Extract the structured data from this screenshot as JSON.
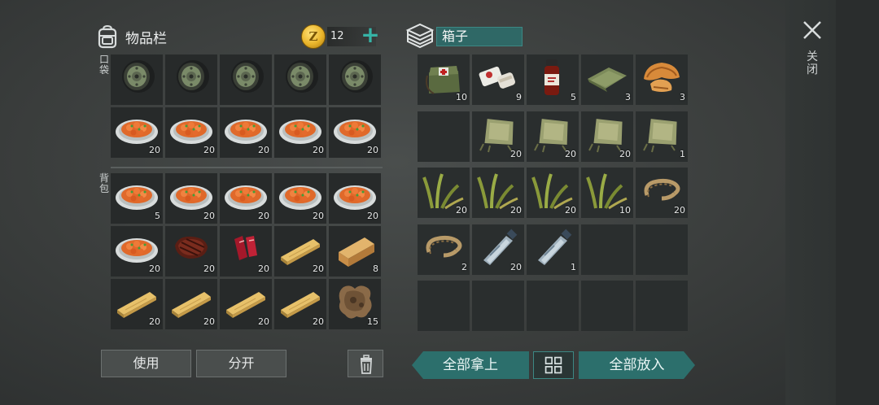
{
  "inventory": {
    "title": "物品栏",
    "coins": "12",
    "pocket_label": "口袋",
    "backpack_label": "背包",
    "pocket": [
      {
        "icon": "wheel-icon",
        "count": ""
      },
      {
        "icon": "wheel-icon",
        "count": ""
      },
      {
        "icon": "wheel-icon",
        "count": ""
      },
      {
        "icon": "wheel-icon",
        "count": ""
      },
      {
        "icon": "wheel-icon",
        "count": ""
      },
      {
        "icon": "stew-icon",
        "count": "20"
      },
      {
        "icon": "stew-icon",
        "count": "20"
      },
      {
        "icon": "stew-icon",
        "count": "20"
      },
      {
        "icon": "stew-icon",
        "count": "20"
      },
      {
        "icon": "stew-icon",
        "count": "20"
      }
    ],
    "backpack": [
      {
        "icon": "stew-icon",
        "count": "5"
      },
      {
        "icon": "stew-icon",
        "count": "20"
      },
      {
        "icon": "stew-icon",
        "count": "20"
      },
      {
        "icon": "stew-icon",
        "count": "20"
      },
      {
        "icon": "stew-icon",
        "count": "20"
      },
      {
        "icon": "stew-icon",
        "count": "20"
      },
      {
        "icon": "steak-icon",
        "count": "20"
      },
      {
        "icon": "raw-meat-icon",
        "count": "20"
      },
      {
        "icon": "plank-icon",
        "count": "20"
      },
      {
        "icon": "log-icon",
        "count": "8"
      },
      {
        "icon": "plank-icon",
        "count": "20"
      },
      {
        "icon": "plank-icon",
        "count": "20"
      },
      {
        "icon": "plank-icon",
        "count": "20"
      },
      {
        "icon": "plank-icon",
        "count": "20"
      },
      {
        "icon": "hide-icon",
        "count": "15"
      }
    ],
    "use_label": "使用",
    "split_label": "分开"
  },
  "box": {
    "title": "箱子",
    "items": [
      {
        "icon": "medkit-bag-icon",
        "count": "10"
      },
      {
        "icon": "bandage-icon",
        "count": "9"
      },
      {
        "icon": "medicine-bottle-icon",
        "count": "5"
      },
      {
        "icon": "cloth-icon",
        "count": "3"
      },
      {
        "icon": "mushroom-icon",
        "count": "3"
      },
      {
        "icon": "",
        "count": ""
      },
      {
        "icon": "rag-icon",
        "count": "20"
      },
      {
        "icon": "rag-icon",
        "count": "20"
      },
      {
        "icon": "rag-icon",
        "count": "20"
      },
      {
        "icon": "rag-icon",
        "count": "1"
      },
      {
        "icon": "plant-fiber-icon",
        "count": "20"
      },
      {
        "icon": "plant-fiber-icon",
        "count": "20"
      },
      {
        "icon": "plant-fiber-icon",
        "count": "20"
      },
      {
        "icon": "plant-fiber-icon",
        "count": "10"
      },
      {
        "icon": "rope-icon",
        "count": "20"
      },
      {
        "icon": "rope-icon",
        "count": "2"
      },
      {
        "icon": "water-bottle-icon",
        "count": "20"
      },
      {
        "icon": "water-bottle-icon",
        "count": "1"
      },
      {
        "icon": "",
        "count": ""
      },
      {
        "icon": "",
        "count": ""
      },
      {
        "icon": "",
        "count": ""
      },
      {
        "icon": "",
        "count": ""
      },
      {
        "icon": "",
        "count": ""
      },
      {
        "icon": "",
        "count": ""
      },
      {
        "icon": "",
        "count": ""
      }
    ],
    "take_all_label": "全部拿上",
    "put_all_label": "全部放入"
  },
  "close_label": "关闭",
  "colors": {
    "accent": "#2c6f6c",
    "cell": "#272a2a",
    "plus": "#36b3a6"
  }
}
